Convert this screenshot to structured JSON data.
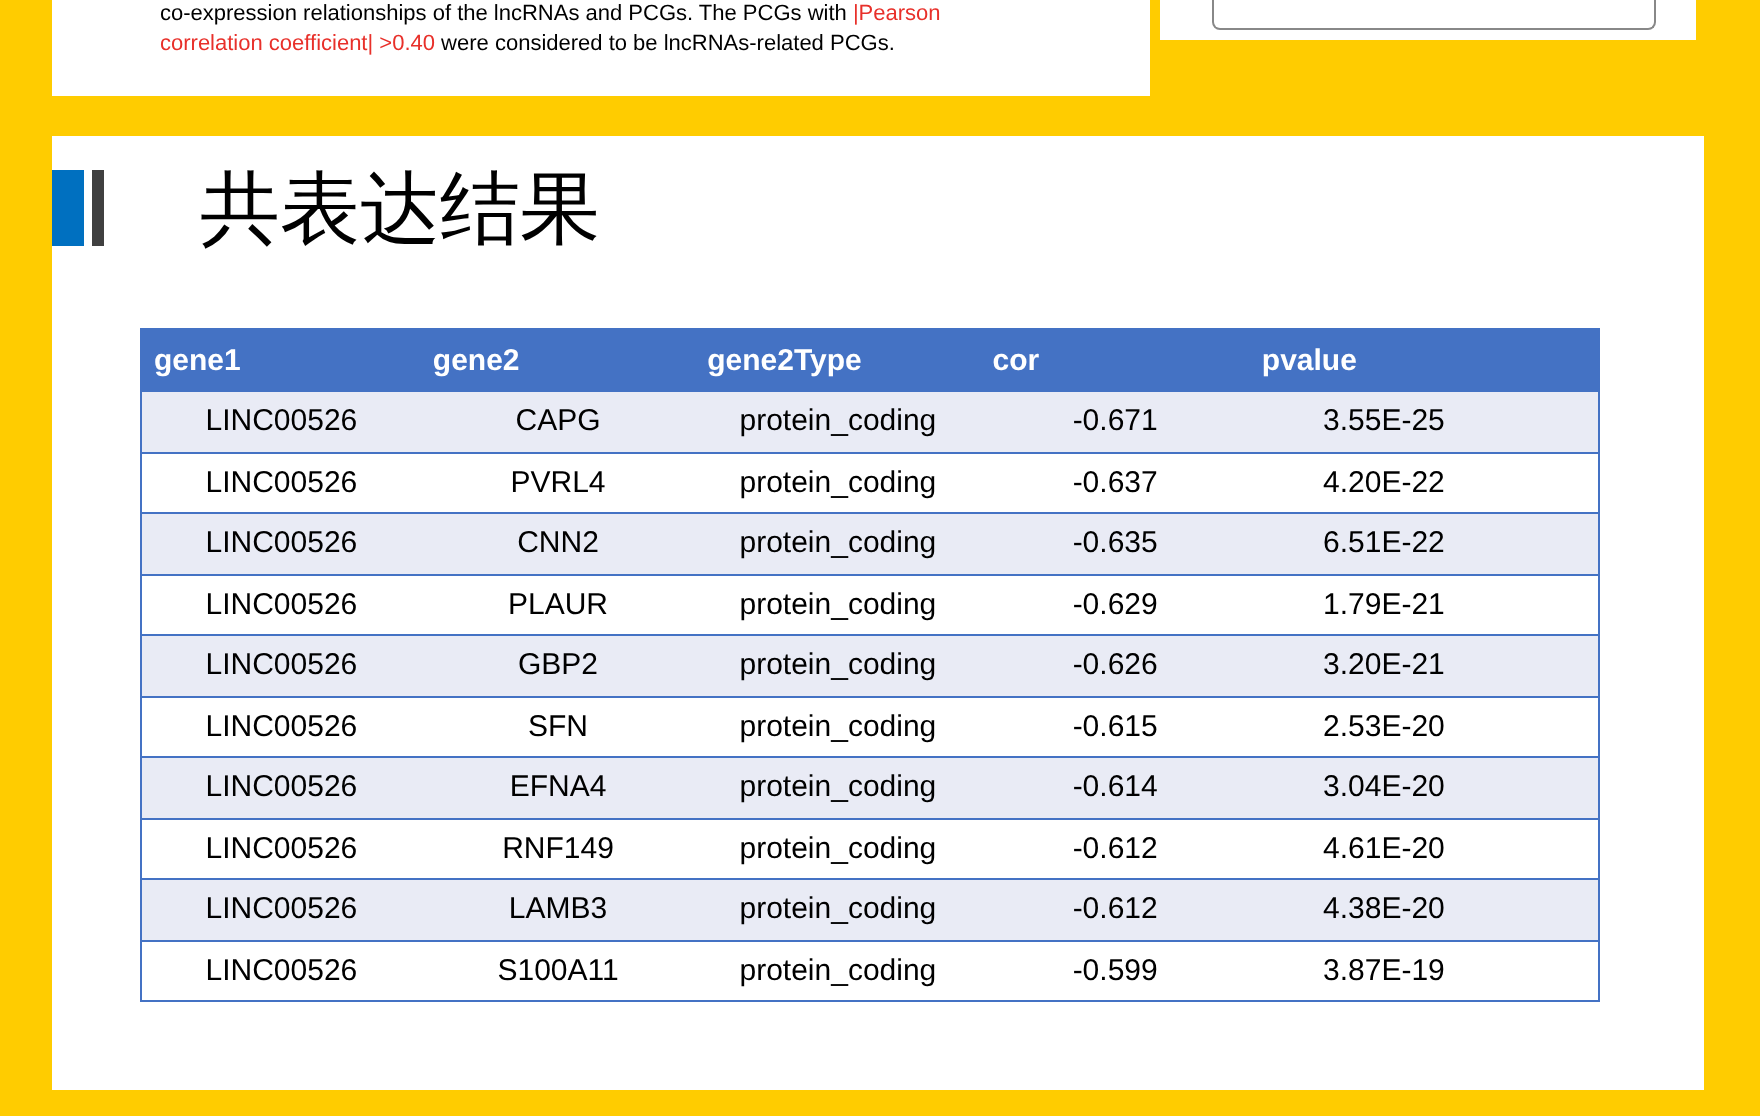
{
  "caption": {
    "lines": [
      [
        {
          "text": "co-expression relationships of the lncRNAs and PCGs. The PCGs with ",
          "highlight": false
        },
        {
          "text": "|Pearson",
          "highlight": true
        }
      ],
      [
        {
          "text": "correlation coefficient| >0.40",
          "highlight": true
        },
        {
          "text": " were considered to be lncRNAs-related PCGs.",
          "highlight": false
        }
      ]
    ]
  },
  "slide": {
    "title": "共表达结果"
  },
  "table": {
    "columns": [
      "gene1",
      "gene2",
      "gene2Type",
      "cor",
      "pvalue"
    ],
    "rows": [
      [
        "LINC00526",
        "CAPG",
        "protein_coding",
        "-0.671",
        "3.55E-25"
      ],
      [
        "LINC00526",
        "PVRL4",
        "protein_coding",
        "-0.637",
        "4.20E-22"
      ],
      [
        "LINC00526",
        "CNN2",
        "protein_coding",
        "-0.635",
        "6.51E-22"
      ],
      [
        "LINC00526",
        "PLAUR",
        "protein_coding",
        "-0.629",
        "1.79E-21"
      ],
      [
        "LINC00526",
        "GBP2",
        "protein_coding",
        "-0.626",
        "3.20E-21"
      ],
      [
        "LINC00526",
        "SFN",
        "protein_coding",
        "-0.615",
        "2.53E-20"
      ],
      [
        "LINC00526",
        "EFNA4",
        "protein_coding",
        "-0.614",
        "3.04E-20"
      ],
      [
        "LINC00526",
        "RNF149",
        "protein_coding",
        "-0.612",
        "4.61E-20"
      ],
      [
        "LINC00526",
        "LAMB3",
        "protein_coding",
        "-0.612",
        "4.38E-20"
      ],
      [
        "LINC00526",
        "S100A11",
        "protein_coding",
        "-0.599",
        "3.87E-19"
      ]
    ]
  }
}
